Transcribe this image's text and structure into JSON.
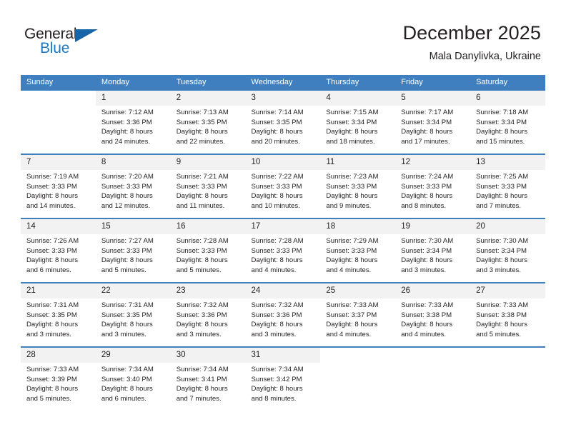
{
  "logo": {
    "word_one": "General",
    "word_two": "Blue",
    "triangle_color": "#1565a8",
    "blue_text_color": "#1e79c3",
    "icon": "triangle-logo-icon"
  },
  "header": {
    "title": "December 2025",
    "subtitle": "Mala Danylivka, Ukraine"
  },
  "theme": {
    "header_row_color": "#3f7fbf",
    "daynum_strip_color": "#f2f2f2",
    "text_color": "#231f20"
  },
  "weekdays": [
    "Sunday",
    "Monday",
    "Tuesday",
    "Wednesday",
    "Thursday",
    "Friday",
    "Saturday"
  ],
  "weeks": [
    [
      {
        "day": "",
        "lines": []
      },
      {
        "day": "1",
        "lines": [
          "Sunrise: 7:12 AM",
          "Sunset: 3:36 PM",
          "Daylight: 8 hours",
          "and 24 minutes."
        ]
      },
      {
        "day": "2",
        "lines": [
          "Sunrise: 7:13 AM",
          "Sunset: 3:35 PM",
          "Daylight: 8 hours",
          "and 22 minutes."
        ]
      },
      {
        "day": "3",
        "lines": [
          "Sunrise: 7:14 AM",
          "Sunset: 3:35 PM",
          "Daylight: 8 hours",
          "and 20 minutes."
        ]
      },
      {
        "day": "4",
        "lines": [
          "Sunrise: 7:15 AM",
          "Sunset: 3:34 PM",
          "Daylight: 8 hours",
          "and 18 minutes."
        ]
      },
      {
        "day": "5",
        "lines": [
          "Sunrise: 7:17 AM",
          "Sunset: 3:34 PM",
          "Daylight: 8 hours",
          "and 17 minutes."
        ]
      },
      {
        "day": "6",
        "lines": [
          "Sunrise: 7:18 AM",
          "Sunset: 3:34 PM",
          "Daylight: 8 hours",
          "and 15 minutes."
        ]
      }
    ],
    [
      {
        "day": "7",
        "lines": [
          "Sunrise: 7:19 AM",
          "Sunset: 3:33 PM",
          "Daylight: 8 hours",
          "and 14 minutes."
        ]
      },
      {
        "day": "8",
        "lines": [
          "Sunrise: 7:20 AM",
          "Sunset: 3:33 PM",
          "Daylight: 8 hours",
          "and 12 minutes."
        ]
      },
      {
        "day": "9",
        "lines": [
          "Sunrise: 7:21 AM",
          "Sunset: 3:33 PM",
          "Daylight: 8 hours",
          "and 11 minutes."
        ]
      },
      {
        "day": "10",
        "lines": [
          "Sunrise: 7:22 AM",
          "Sunset: 3:33 PM",
          "Daylight: 8 hours",
          "and 10 minutes."
        ]
      },
      {
        "day": "11",
        "lines": [
          "Sunrise: 7:23 AM",
          "Sunset: 3:33 PM",
          "Daylight: 8 hours",
          "and 9 minutes."
        ]
      },
      {
        "day": "12",
        "lines": [
          "Sunrise: 7:24 AM",
          "Sunset: 3:33 PM",
          "Daylight: 8 hours",
          "and 8 minutes."
        ]
      },
      {
        "day": "13",
        "lines": [
          "Sunrise: 7:25 AM",
          "Sunset: 3:33 PM",
          "Daylight: 8 hours",
          "and 7 minutes."
        ]
      }
    ],
    [
      {
        "day": "14",
        "lines": [
          "Sunrise: 7:26 AM",
          "Sunset: 3:33 PM",
          "Daylight: 8 hours",
          "and 6 minutes."
        ]
      },
      {
        "day": "15",
        "lines": [
          "Sunrise: 7:27 AM",
          "Sunset: 3:33 PM",
          "Daylight: 8 hours",
          "and 5 minutes."
        ]
      },
      {
        "day": "16",
        "lines": [
          "Sunrise: 7:28 AM",
          "Sunset: 3:33 PM",
          "Daylight: 8 hours",
          "and 5 minutes."
        ]
      },
      {
        "day": "17",
        "lines": [
          "Sunrise: 7:28 AM",
          "Sunset: 3:33 PM",
          "Daylight: 8 hours",
          "and 4 minutes."
        ]
      },
      {
        "day": "18",
        "lines": [
          "Sunrise: 7:29 AM",
          "Sunset: 3:33 PM",
          "Daylight: 8 hours",
          "and 4 minutes."
        ]
      },
      {
        "day": "19",
        "lines": [
          "Sunrise: 7:30 AM",
          "Sunset: 3:34 PM",
          "Daylight: 8 hours",
          "and 3 minutes."
        ]
      },
      {
        "day": "20",
        "lines": [
          "Sunrise: 7:30 AM",
          "Sunset: 3:34 PM",
          "Daylight: 8 hours",
          "and 3 minutes."
        ]
      }
    ],
    [
      {
        "day": "21",
        "lines": [
          "Sunrise: 7:31 AM",
          "Sunset: 3:35 PM",
          "Daylight: 8 hours",
          "and 3 minutes."
        ]
      },
      {
        "day": "22",
        "lines": [
          "Sunrise: 7:31 AM",
          "Sunset: 3:35 PM",
          "Daylight: 8 hours",
          "and 3 minutes."
        ]
      },
      {
        "day": "23",
        "lines": [
          "Sunrise: 7:32 AM",
          "Sunset: 3:36 PM",
          "Daylight: 8 hours",
          "and 3 minutes."
        ]
      },
      {
        "day": "24",
        "lines": [
          "Sunrise: 7:32 AM",
          "Sunset: 3:36 PM",
          "Daylight: 8 hours",
          "and 3 minutes."
        ]
      },
      {
        "day": "25",
        "lines": [
          "Sunrise: 7:33 AM",
          "Sunset: 3:37 PM",
          "Daylight: 8 hours",
          "and 4 minutes."
        ]
      },
      {
        "day": "26",
        "lines": [
          "Sunrise: 7:33 AM",
          "Sunset: 3:38 PM",
          "Daylight: 8 hours",
          "and 4 minutes."
        ]
      },
      {
        "day": "27",
        "lines": [
          "Sunrise: 7:33 AM",
          "Sunset: 3:38 PM",
          "Daylight: 8 hours",
          "and 5 minutes."
        ]
      }
    ],
    [
      {
        "day": "28",
        "lines": [
          "Sunrise: 7:33 AM",
          "Sunset: 3:39 PM",
          "Daylight: 8 hours",
          "and 5 minutes."
        ]
      },
      {
        "day": "29",
        "lines": [
          "Sunrise: 7:34 AM",
          "Sunset: 3:40 PM",
          "Daylight: 8 hours",
          "and 6 minutes."
        ]
      },
      {
        "day": "30",
        "lines": [
          "Sunrise: 7:34 AM",
          "Sunset: 3:41 PM",
          "Daylight: 8 hours",
          "and 7 minutes."
        ]
      },
      {
        "day": "31",
        "lines": [
          "Sunrise: 7:34 AM",
          "Sunset: 3:42 PM",
          "Daylight: 8 hours",
          "and 8 minutes."
        ]
      },
      {
        "day": "",
        "lines": []
      },
      {
        "day": "",
        "lines": []
      },
      {
        "day": "",
        "lines": []
      }
    ]
  ]
}
